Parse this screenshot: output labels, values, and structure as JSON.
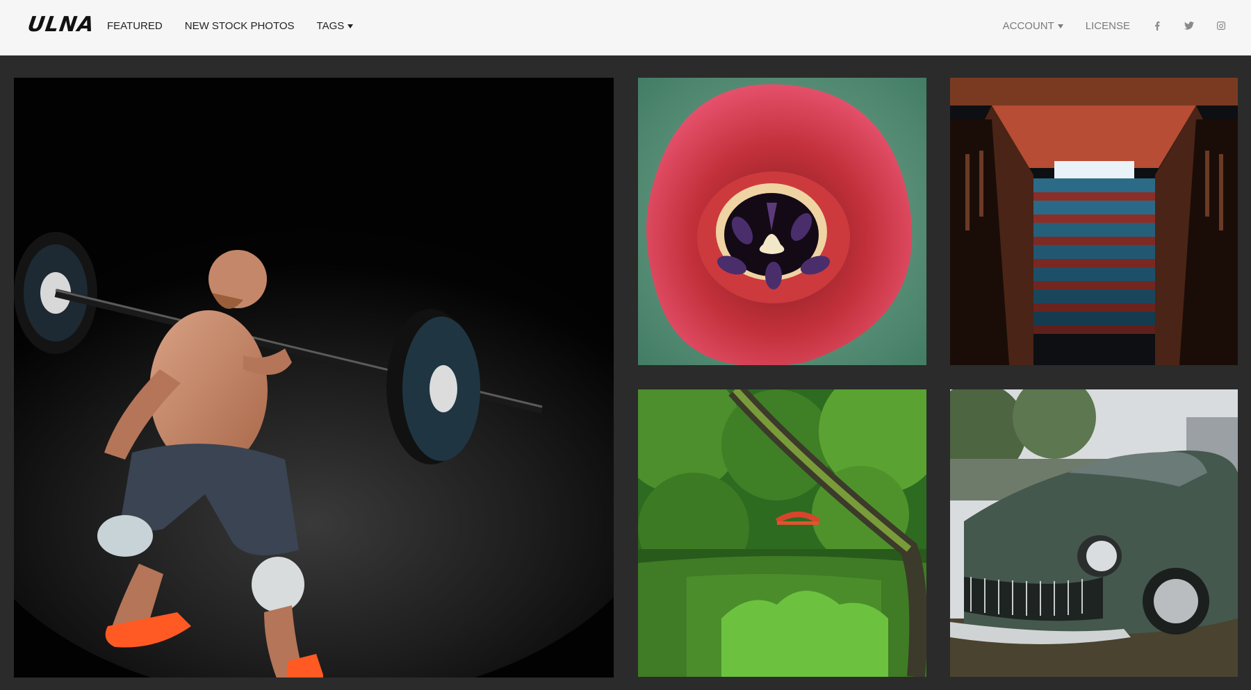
{
  "brand": {
    "logo_text": "ULNA"
  },
  "nav": {
    "left": [
      {
        "label": "FEATURED"
      },
      {
        "label": "NEW STOCK PHOTOS"
      },
      {
        "label": "TAGS",
        "dropdown": true
      }
    ],
    "right": [
      {
        "label": "ACCOUNT",
        "dropdown": true
      },
      {
        "label": "LICENSE"
      }
    ],
    "social_icons": [
      "facebook-icon",
      "twitter-icon",
      "instagram-icon"
    ]
  },
  "gallery": {
    "photos": [
      {
        "name": "weightlifter-photo",
        "subject": "weightlifter"
      },
      {
        "name": "tulip-photo",
        "subject": "tulip"
      },
      {
        "name": "staircase-photo",
        "subject": "staircase"
      },
      {
        "name": "garden-photo",
        "subject": "garden"
      },
      {
        "name": "sports-car-photo",
        "subject": "sports car"
      }
    ]
  },
  "colors": {
    "header_bg": "#f6f6f6",
    "page_bg": "#2b2b2b",
    "nav_text": "#222222",
    "nav_muted": "#7a7a7a"
  }
}
